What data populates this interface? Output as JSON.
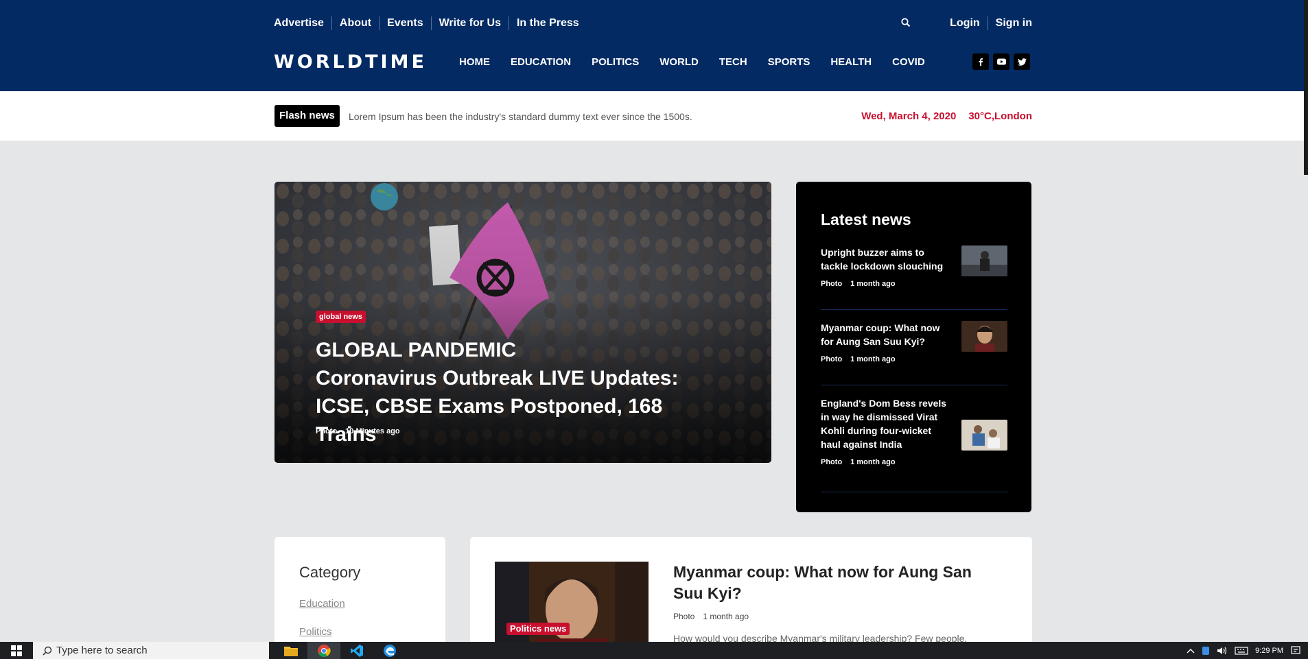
{
  "top_links": [
    "Advertise",
    "About",
    "Events",
    "Write for Us",
    "In the Press"
  ],
  "auth": {
    "login": "Login",
    "signin": "Sign in"
  },
  "logo": "WORLDTIME",
  "main_nav": [
    "HOME",
    "EDUCATION",
    "POLITICS",
    "WORLD",
    "TECH",
    "SPORTS",
    "HEALTH",
    "COVID"
  ],
  "social_icons": [
    "facebook-icon",
    "youtube-icon",
    "twitter-icon"
  ],
  "flash": {
    "badge": "Flash news",
    "text": "Lorem Ipsum has been the industry's standard dummy text ever since the 1500s.",
    "date": "Wed, March 4, 2020",
    "weather": "30°C,London"
  },
  "hero": {
    "tag": "global news",
    "title_line1": "GLOBAL PANDEMIC",
    "title_line2": "Coronavirus Outbreak LIVE Updates: ICSE, CBSE Exams Postponed, 168 Trains",
    "meta_type": "Photo",
    "meta_time": "10 Minutes ago"
  },
  "latest": {
    "title": "Latest news",
    "items": [
      {
        "title": "Upright buzzer aims to tackle lockdown slouching",
        "type": "Photo",
        "time": "1 month ago"
      },
      {
        "title": "Myanmar coup: What now for Aung San Suu Kyi?",
        "type": "Photo",
        "time": "1 month ago"
      },
      {
        "title": "England's Dom Bess revels in way he dismissed Virat Kohli during four-wicket haul against India",
        "type": "Photo",
        "time": "1 month ago"
      }
    ]
  },
  "category": {
    "title": "Category",
    "items": [
      "Education",
      "Politics"
    ]
  },
  "article": {
    "tag": "Politics news",
    "title": "Myanmar coup: What now for Aung San Suu Kyi?",
    "type": "Photo",
    "time": "1 month ago",
    "excerpt": "How would you describe Myanmar's military leadership? Few people,"
  },
  "taskbar": {
    "search_placeholder": "Type here to search",
    "time": "9:29 PM"
  },
  "colors": {
    "header_bg": "#032a63",
    "accent_red": "#c8102e",
    "page_bg": "#e5e6e8"
  }
}
